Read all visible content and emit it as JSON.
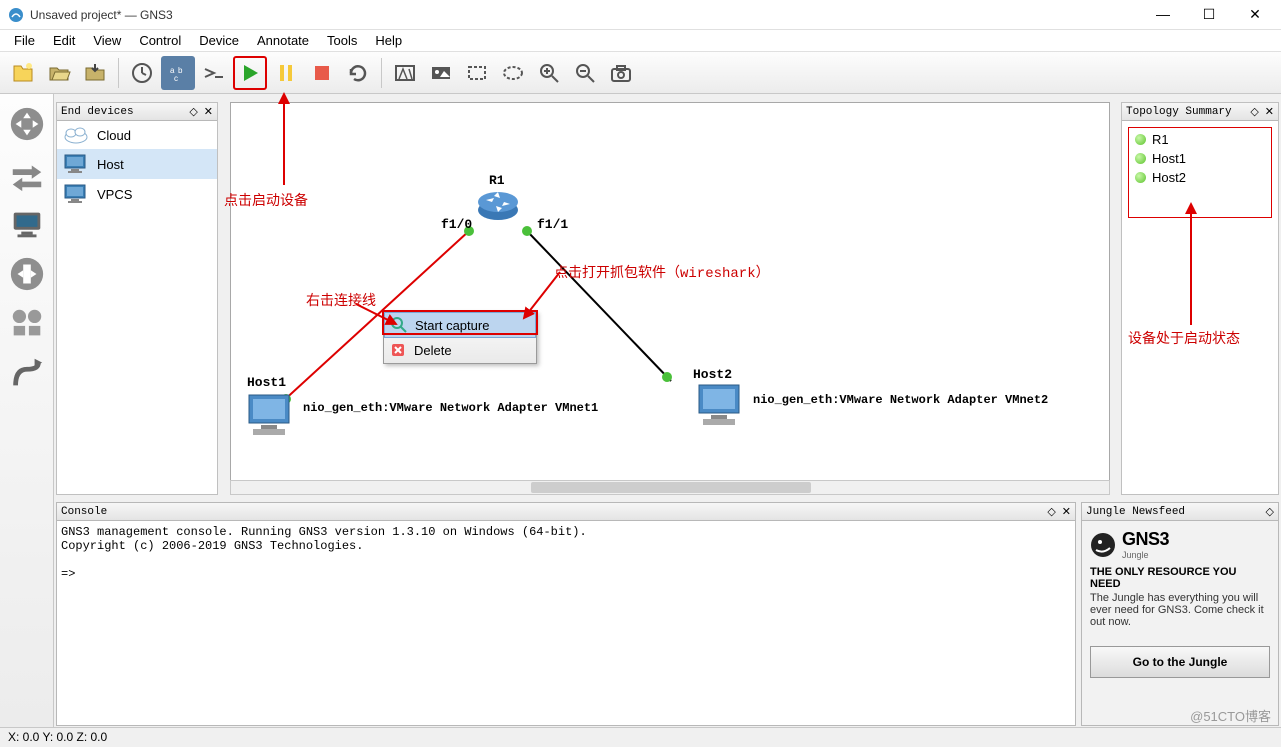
{
  "window": {
    "title": "Unsaved project* — GNS3",
    "controls": {
      "min": "—",
      "max": "☐",
      "close": "✕"
    }
  },
  "menu": [
    "File",
    "Edit",
    "View",
    "Control",
    "Device",
    "Annotate",
    "Tools",
    "Help"
  ],
  "annotations": {
    "start": "点击启动设备",
    "rightclick": "右击连接线",
    "wireshark": "点击打开抓包软件（wireshark）",
    "running": "设备处于启动状态"
  },
  "end_devices": {
    "title": "End devices",
    "items": [
      "Cloud",
      "Host",
      "VPCS"
    ],
    "selected": 1
  },
  "topology": {
    "r1": "R1",
    "f10": "f1/0",
    "f11": "f1/1",
    "host1": "Host1",
    "host2": "Host2",
    "nic1": "nio_gen_eth:VMware Network Adapter VMnet1",
    "nic2": "nio_gen_eth:VMware Network Adapter VMnet2"
  },
  "context_menu": {
    "start_capture": "Start capture",
    "delete": "Delete"
  },
  "topo_summary": {
    "title": "Topology Summary",
    "items": [
      "R1",
      "Host1",
      "Host2"
    ]
  },
  "console": {
    "title": "Console",
    "line1": "GNS3 management console. Running GNS3 version 1.3.10 on Windows (64-bit).",
    "line2": "Copyright (c) 2006-2019 GNS3 Technologies.",
    "prompt": "=>"
  },
  "jungle": {
    "title": "Jungle Newsfeed",
    "brand": "GNS3",
    "brand_sub": "Jungle",
    "heading": "THE ONLY RESOURCE YOU NEED",
    "body": "The Jungle has everything you will ever need for GNS3. Come check it out now.",
    "button": "Go to the Jungle"
  },
  "statusbar": "X: 0.0 Y: 0.0 Z: 0.0",
  "watermark": "@51CTO博客"
}
